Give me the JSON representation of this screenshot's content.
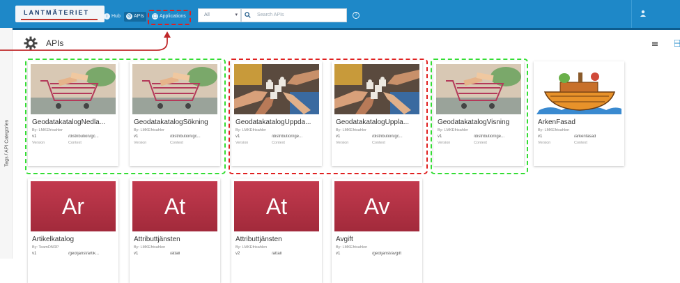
{
  "header": {
    "brand": "LANTMÄTERIET",
    "nav": [
      {
        "label": "Hub",
        "icon": "info-icon"
      },
      {
        "label": "APIs",
        "icon": "gear-icon"
      },
      {
        "label": "Applications",
        "icon": "app-icon"
      }
    ],
    "filter_select": "All",
    "search_placeholder": "Search APIs",
    "help_icon": "help-icon",
    "user_icon": "user-icon"
  },
  "sidebar": {
    "vertical_label": "Tags / API Categories"
  },
  "page": {
    "title": "APIs",
    "view_icons": [
      "list-view-icon",
      "grid-view-icon"
    ]
  },
  "colors": {
    "topbar": "#1e88c8",
    "highlight_green": "#33dd33",
    "highlight_red": "#e02020",
    "tile_red": "#b2323f"
  },
  "apis": [
    {
      "name": "GeodatakatalogNedla...",
      "by": "By: LMKEfrisahler",
      "version": "v1",
      "context": "/distribution/gc...",
      "version_label": "Version",
      "context_label": "Context",
      "thumb": "shopping-cart"
    },
    {
      "name": "GeodatakatalogSökning",
      "by": "By: LMKEfrisahler",
      "version": "v1",
      "context": "/distribution/gc...",
      "version_label": "Version",
      "context_label": "Context",
      "thumb": "shopping-cart"
    },
    {
      "name": "GeodatakatalogUppda...",
      "by": "By: LMKEfrisahler",
      "version": "v1",
      "context": "/distribution/ge...",
      "version_label": "Version",
      "context_label": "Context",
      "thumb": "puzzle-hands"
    },
    {
      "name": "GeodatakatalogUppla...",
      "by": "By: LMKEfrisahler",
      "version": "v1",
      "context": "/distribution/gc...",
      "version_label": "Version",
      "context_label": "Context",
      "thumb": "puzzle-hands"
    },
    {
      "name": "GeodatakatalogVisning",
      "by": "By: LMKEfrisahler",
      "version": "v1",
      "context": "/distribution/ge...",
      "version_label": "Version",
      "context_label": "Context",
      "thumb": "shopping-cart"
    },
    {
      "name": "ArkenFasad",
      "by": "By: LMKEfrisahlen",
      "version": "v1",
      "context": "/arkenfasad",
      "version_label": "Version",
      "context_label": "Context",
      "thumb": "noahs-ark"
    },
    {
      "name": "Artikelkatalog",
      "by": "By: TeamDNRP",
      "version": "v1",
      "context": "/geotjanst/artik...",
      "version_label": "Version",
      "context_label": "Context",
      "thumb": "tile",
      "tile_text": "Ar"
    },
    {
      "name": "Attributtjänsten",
      "by": "By: LMKEfrisahlen",
      "version": "v1",
      "context": "/attall",
      "version_label": "Version",
      "context_label": "Context",
      "thumb": "tile",
      "tile_text": "At"
    },
    {
      "name": "Attributtjänsten",
      "by": "By: LMKEfrisahlen",
      "version": "v2",
      "context": "/attall",
      "version_label": "Version",
      "context_label": "Context",
      "thumb": "tile",
      "tile_text": "At"
    },
    {
      "name": "Avgift",
      "by": "By: LMKEfrisahlen",
      "version": "v1",
      "context": "/geotjanst/avgift",
      "version_label": "Version",
      "context_label": "Context",
      "thumb": "tile",
      "tile_text": "Av"
    }
  ]
}
